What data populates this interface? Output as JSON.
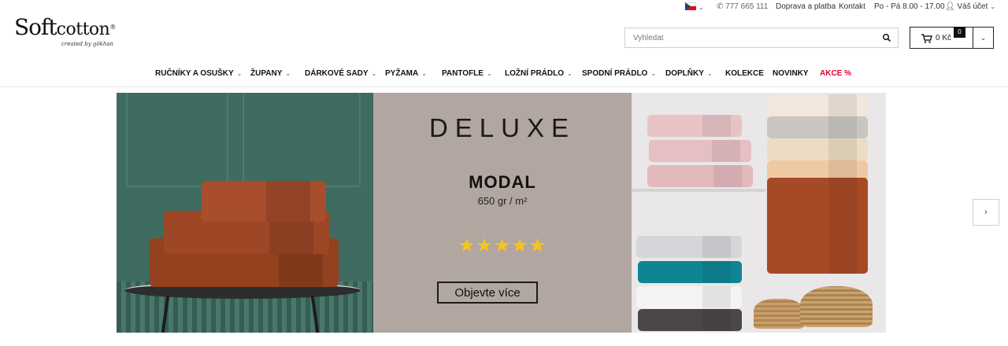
{
  "topbar": {
    "language_icon": "czech-flag-icon",
    "phone": "777 665 111",
    "shipping_link": "Doprava a platba",
    "contact_link": "Kontakt",
    "hours": "Po - Pá 8.00 - 17.00",
    "account_label": "Váš účet"
  },
  "header": {
    "logo_main": "Soft",
    "logo_second": "cotton",
    "logo_mark": "®",
    "logo_tagline": "created by gökhan",
    "search_placeholder": "Vyhledat",
    "cart_total": "0 Kč",
    "cart_count": "0"
  },
  "nav": {
    "items": [
      {
        "label": "RUČNÍKY A OSUŠKY",
        "dropdown": true
      },
      {
        "label": "ŽUPANY",
        "dropdown": true
      },
      {
        "label": "DÁRKOVÉ SADY",
        "dropdown": true
      },
      {
        "label": "PYŽAMA",
        "dropdown": true
      },
      {
        "label": "PANTOFLE",
        "dropdown": true
      },
      {
        "label": "LOŽNÍ PRÁDLO",
        "dropdown": true
      },
      {
        "label": "SPODNÍ PRÁDLO",
        "dropdown": true
      },
      {
        "label": "DOPLŇKY",
        "dropdown": true
      },
      {
        "label": "KOLEKCE",
        "dropdown": false
      },
      {
        "label": "NOVINKY",
        "dropdown": false
      },
      {
        "label": "AKCE %",
        "dropdown": false
      }
    ],
    "sale_color": "#e4002b"
  },
  "hero": {
    "headline": "DELUXE",
    "product_name": "MODAL",
    "weight": "650 gr / m²",
    "stars": "★★★★★",
    "rating": 5,
    "cta_label": "Objevte více",
    "star_color": "#f6c51d",
    "next_arrow": "›"
  }
}
